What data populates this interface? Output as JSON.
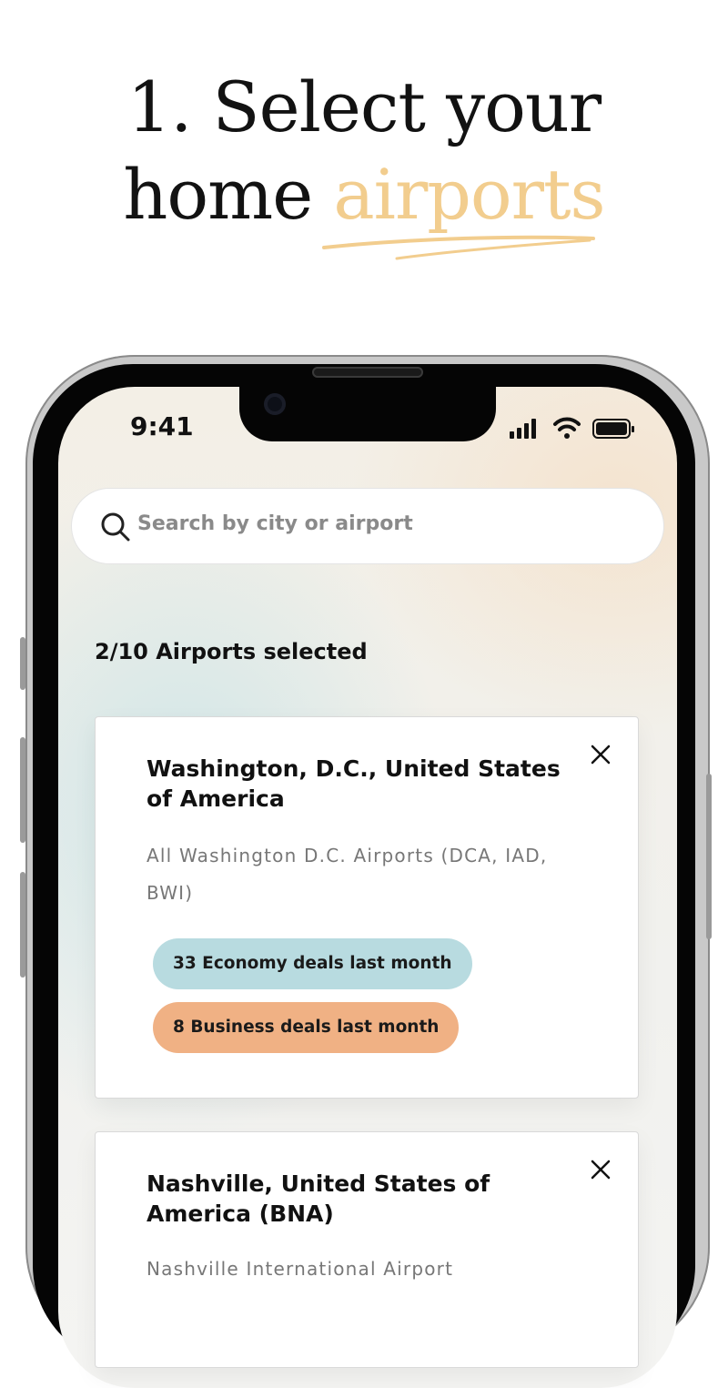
{
  "headline": {
    "line1": "1. Select your",
    "line2_plain": "home ",
    "line2_accent": "airports"
  },
  "status_bar": {
    "time": "9:41"
  },
  "search": {
    "placeholder": "Search by city or airport"
  },
  "selected_count": "2/10 Airports selected",
  "cards": [
    {
      "title": "Washington, D.C., United States of America",
      "description": "All Washington D.C. Airports (DCA, IAD, BWI)",
      "economy_deals": "33 Economy deals last month",
      "business_deals": "8 Business deals last month"
    },
    {
      "title": "Nashville, United States of America (BNA)",
      "description": "Nashville International Airport"
    }
  ],
  "colors": {
    "accent": "#f2cd8e",
    "economy_pill": "#b8dbe0",
    "business_pill": "#f0b184"
  }
}
